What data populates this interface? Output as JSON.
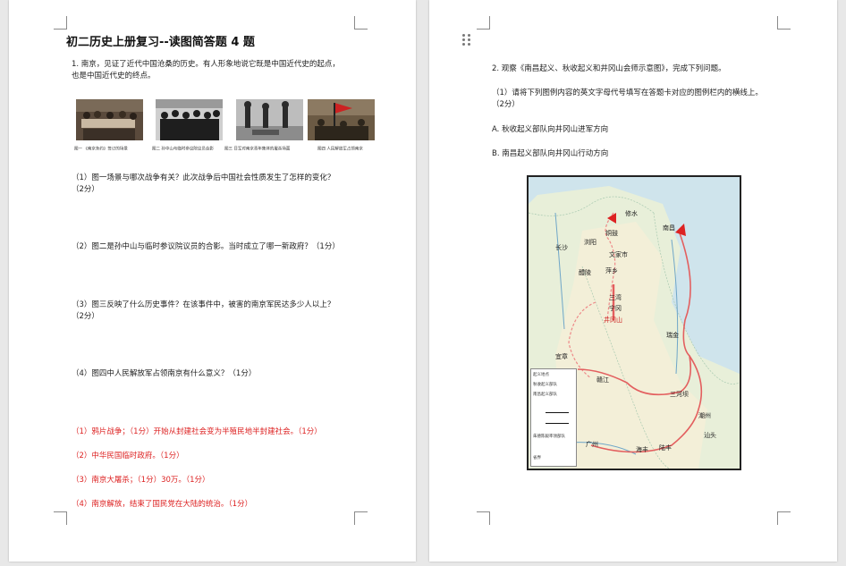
{
  "left": {
    "title": "初二历史上册复习--读图简答题 4 题",
    "q1_intro_line1": "1. 南京，见证了近代中国沧桑的历史。有人形象地说它既是中国近代史的起点，",
    "q1_intro_line2": "也是中国近代史的终点。",
    "captions": [
      "图一 《南京条约》签订的场景",
      "图二 孙中山与临时参议院议员合影",
      "图三 日军对南京青年集体的屠杀场面",
      "图四 人民解放军占领南京"
    ],
    "q1_sub1_line1": "（1）图一场景与哪次战争有关？此次战争后中国社会性质发生了怎样的变化？",
    "q1_sub1_line2": "（2分）",
    "q1_sub2": "（2）图二是孙中山与临时参议院议员的合影。当时成立了哪一新政府？（1分）",
    "q1_sub3_line1": "（3）图三反映了什么历史事件？在该事件中，被害的南京军民达多少人以上？",
    "q1_sub3_line2": "（2分）",
    "q1_sub4": "（4）图四中人民解放军占领南京有什么意义？（1分）",
    "answers": [
      "（1）鸦片战争；（1分）开始从封建社会变为半殖民地半封建社会。（1分）",
      "（2）中华民国临时政府。（1分）",
      "（3）南京大屠杀；（1分）30万。（1分）",
      "（4）南京解放，结束了国民党在大陆的统治。（1分）"
    ]
  },
  "right": {
    "q2_intro": "2. 观察《南昌起义、秋收起义和井冈山会师示意图》，完成下列问题。",
    "q2_sub1_line1": "（1）请将下列图例内容的英文字母代号填写在答题卡对应的图例栏内的横线上。",
    "q2_sub1_line2": "（2分）",
    "option_a": "A. 秋收起义部队向井冈山进军方向",
    "option_b": "B. 南昌起义部队向井冈山行动方向",
    "map_labels": {
      "nanchang": "南昌",
      "changsha": "长沙",
      "liuyang": "浏阳",
      "xiushui": "修水",
      "tongguzhen": "铜鼓",
      "wenjiashi": "文家市",
      "pingxiang": "萍乡",
      "liling": "醴陵",
      "sanwan": "三湾",
      "jinggangshan": "井冈山",
      "ninggang": "宁冈",
      "ruijin": "瑞金",
      "sanhebei": "三河坝",
      "chaozhou": "潮州",
      "shantou": "汕头",
      "guangzhou": "广州",
      "lufeng": "陆丰",
      "haifeng": "海丰",
      "ganzhou": "赣江",
      "yizhang": "宜章"
    },
    "legend_items": [
      "起义地点",
      "秋收起义部队",
      "南昌起义部队",
      "",
      "",
      "朱德陈毅率领部队",
      "省界"
    ]
  }
}
